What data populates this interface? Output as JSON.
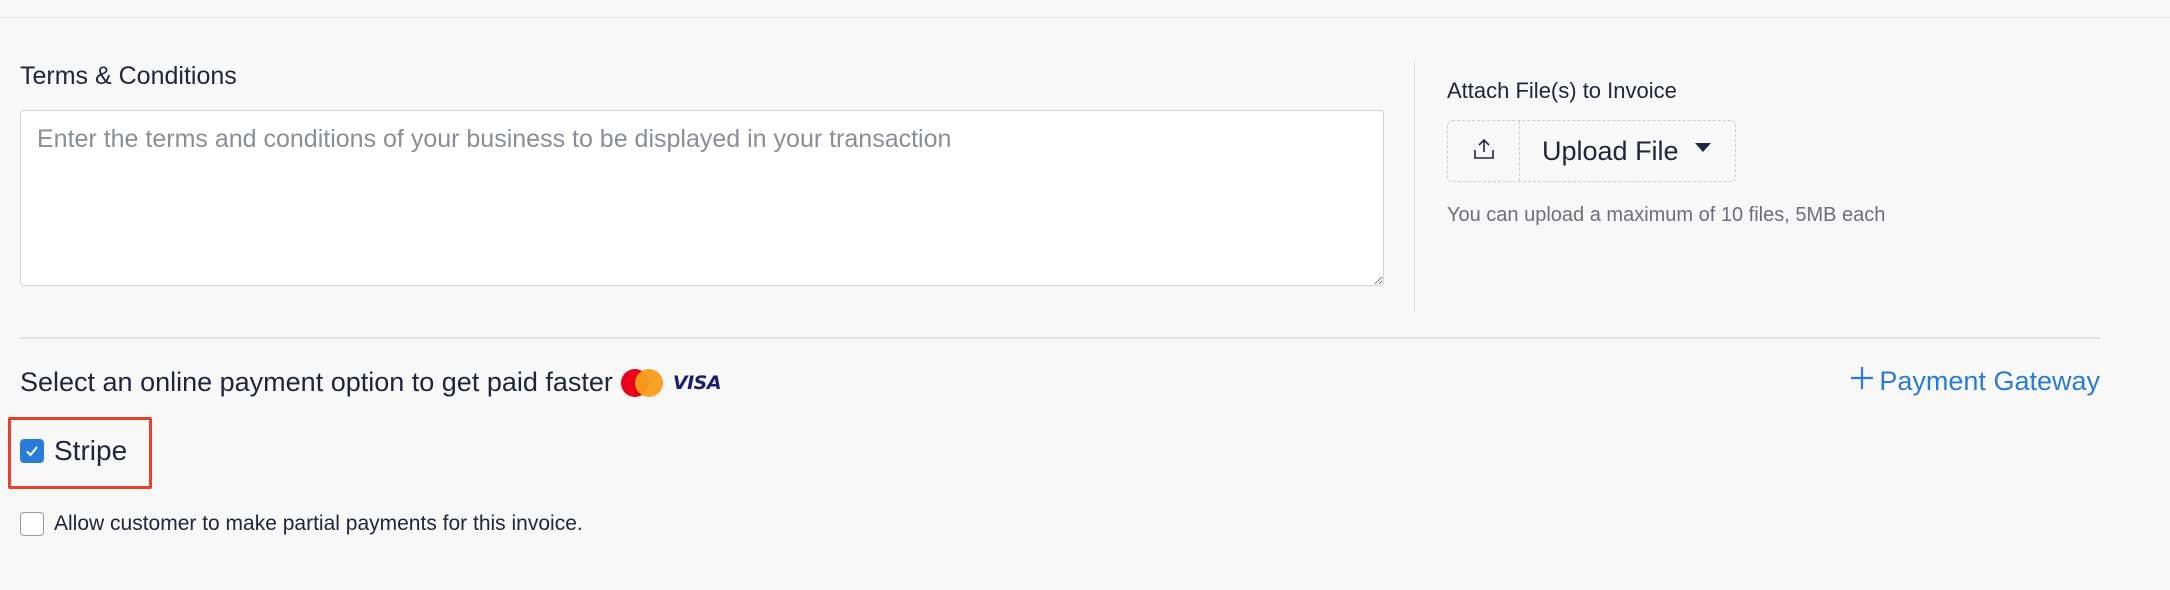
{
  "terms": {
    "label": "Terms & Conditions",
    "placeholder": "Enter the terms and conditions of your business to be displayed in your transaction",
    "value": ""
  },
  "attachments": {
    "label": "Attach File(s) to Invoice",
    "upload_button_label": "Upload File",
    "upload_icon": "upload-icon",
    "hint": "You can upload a maximum of 10 files, 5MB each"
  },
  "payment": {
    "title": "Select an online payment option to get paid faster",
    "card_icons": [
      "mastercard-icon",
      "visa-icon"
    ],
    "visa_text": "VISA",
    "gateway_link_label": "Payment Gateway",
    "gateway_link_icon": "plus-icon",
    "options": [
      {
        "label": "Stripe",
        "checked": true
      }
    ],
    "partial_payments_label": "Allow customer to make partial payments for this invoice.",
    "partial_payments_checked": false
  },
  "colors": {
    "accent": "#2a7bd8",
    "highlight_border": "#e8412c",
    "mastercard_red": "#eb001b",
    "mastercard_orange": "#f79e1b",
    "visa_blue": "#1a1f71"
  }
}
